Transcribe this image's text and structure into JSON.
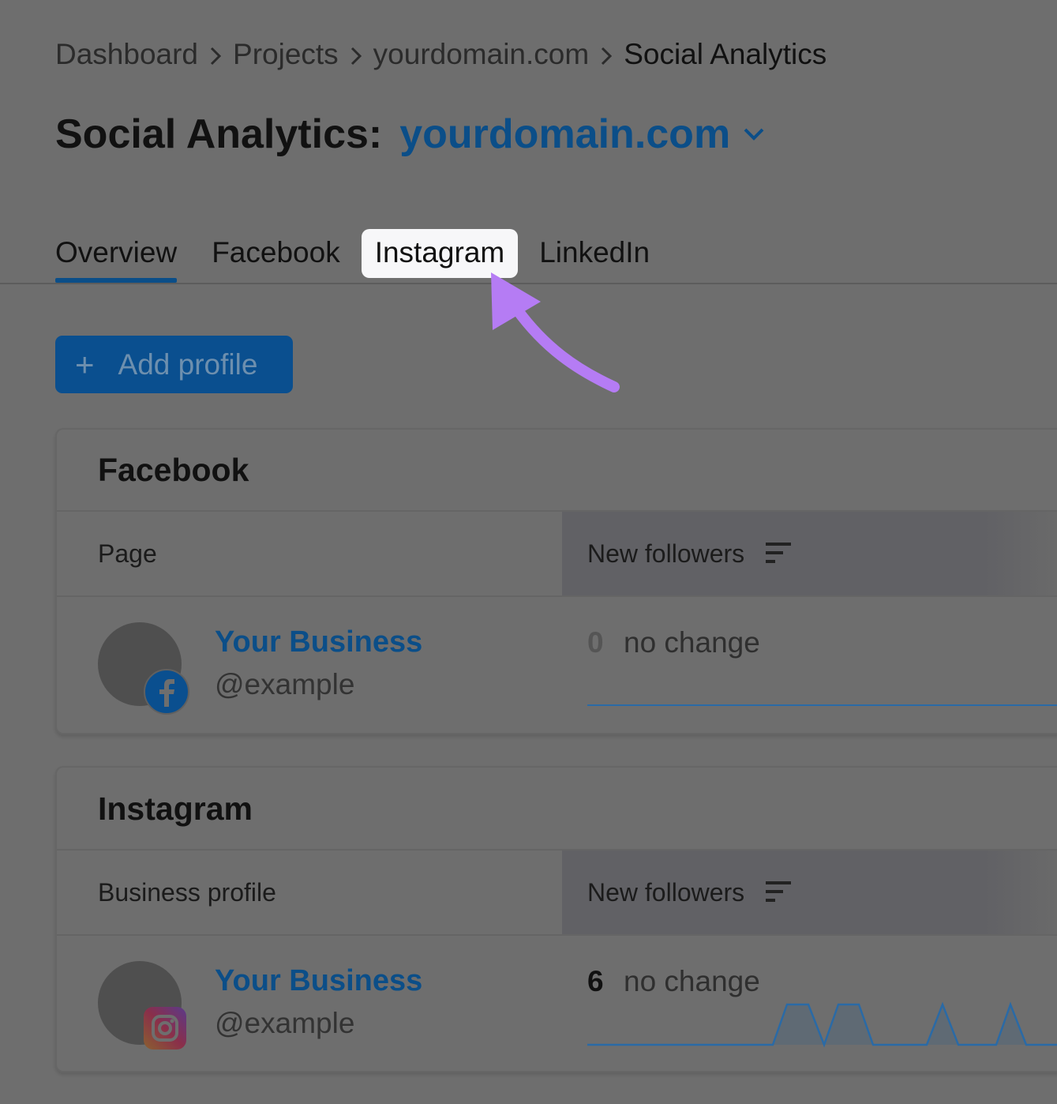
{
  "breadcrumb": {
    "items": [
      "Dashboard",
      "Projects",
      "yourdomain.com",
      "Social Analytics"
    ]
  },
  "header": {
    "title_label": "Social Analytics:",
    "domain": "yourdomain.com"
  },
  "tabs": [
    {
      "label": "Overview",
      "active": true
    },
    {
      "label": "Facebook",
      "active": false
    },
    {
      "label": "Instagram",
      "active": false,
      "highlighted": true
    },
    {
      "label": "LinkedIn",
      "active": false
    }
  ],
  "add_profile": {
    "label": "Add profile"
  },
  "sections": {
    "facebook": {
      "title": "Facebook",
      "col_left": "Page",
      "col_right": "New followers",
      "row": {
        "name": "Your Business",
        "handle": "@example",
        "value": "0",
        "change": "no change"
      }
    },
    "instagram": {
      "title": "Instagram",
      "col_left": "Business profile",
      "col_right": "New followers",
      "row": {
        "name": "Your Business",
        "handle": "@example",
        "value": "6",
        "change": "no change"
      }
    }
  },
  "colors": {
    "overlay_bg": "#6e6e6e",
    "accent_blue": "#0b4e88",
    "arrow_purple": "#b57cf4",
    "sparkline": "#2a6aa6"
  },
  "icons": [
    "chevron-right-icon",
    "chevron-down-icon",
    "plus-icon",
    "sort-icon",
    "facebook-icon",
    "instagram-icon",
    "pointer-arrow-icon"
  ]
}
